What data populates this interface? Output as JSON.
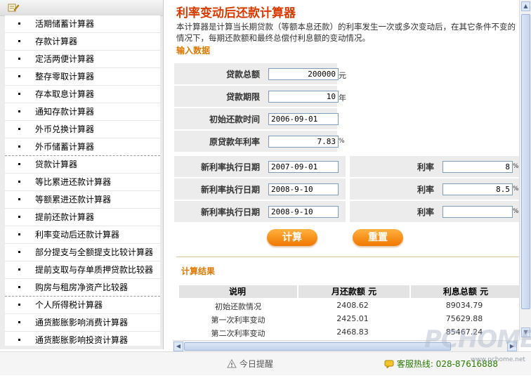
{
  "sidebar": {
    "items": [
      {
        "label": "活期储蓄计算器"
      },
      {
        "label": "存款计算器"
      },
      {
        "label": "定活两便计算器"
      },
      {
        "label": "整存零取计算器"
      },
      {
        "label": "存本取息计算器"
      },
      {
        "label": "通知存款计算器"
      },
      {
        "label": "外币兑换计算器"
      },
      {
        "label": "外币储蓄计算器"
      },
      {
        "label": "贷款计算器"
      },
      {
        "label": "等比累进还款计算器"
      },
      {
        "label": "等额累进还款计算器"
      },
      {
        "label": "提前还款计算器"
      },
      {
        "label": "利率变动后还款计算器"
      },
      {
        "label": "部分提支与全额提支比较计算器"
      },
      {
        "label": "提前支取与存单质押贷款比较器"
      },
      {
        "label": "购房与租房净资产比较器"
      },
      {
        "label": "个人所得税计算器"
      },
      {
        "label": "通货膨胀影响消费计算器"
      },
      {
        "label": "通货膨胀影响投资计算器"
      }
    ]
  },
  "main": {
    "title": "利率变动后还款计算器",
    "description": "本计算器是计算当长期贷款（等额本息还款）的利率发生一次或多次变动后，在其它条件不变的情况下，每期还款额和最终总偿付利息额的变动情况。",
    "input_section": "输入数据",
    "loan_amount": {
      "label": "贷款总额",
      "value": "200000",
      "unit": "元"
    },
    "loan_term": {
      "label": "贷款期限",
      "value": "10",
      "unit": "年"
    },
    "start_date": {
      "label": "初始还款时间",
      "value": "2006-09-01"
    },
    "orig_rate": {
      "label": "原贷款年利率",
      "value": "7.83",
      "unit": "%"
    },
    "changes": [
      {
        "date_label": "新利率执行日期",
        "date": "2007-09-01",
        "rate_label": "利率",
        "rate": "8",
        "unit": "%"
      },
      {
        "date_label": "新利率执行日期",
        "date": "2008-9-10",
        "rate_label": "利率",
        "rate": "8.5",
        "unit": "%"
      },
      {
        "date_label": "新利率执行日期",
        "date": "2008-9-10",
        "rate_label": "利率",
        "rate": "",
        "unit": "%"
      }
    ],
    "calc_button": "计算",
    "reset_button": "重置",
    "result_section": "计算结果",
    "table": {
      "headers": [
        "说明",
        "月还款额  元",
        "利息总额  元"
      ],
      "rows": [
        [
          "初始还款情况",
          "2408.62",
          "89034.79"
        ],
        [
          "第一次利率变动",
          "2425.01",
          "75629.88"
        ],
        [
          "第二次利率变动",
          "2468.83",
          "85467.24"
        ]
      ]
    }
  },
  "statusbar": {
    "reminder": "今日提醒",
    "hotline": "客服热线: 028-87616888"
  },
  "watermark": {
    "brand": "PCHOME",
    "url": "www.pchome.net"
  }
}
